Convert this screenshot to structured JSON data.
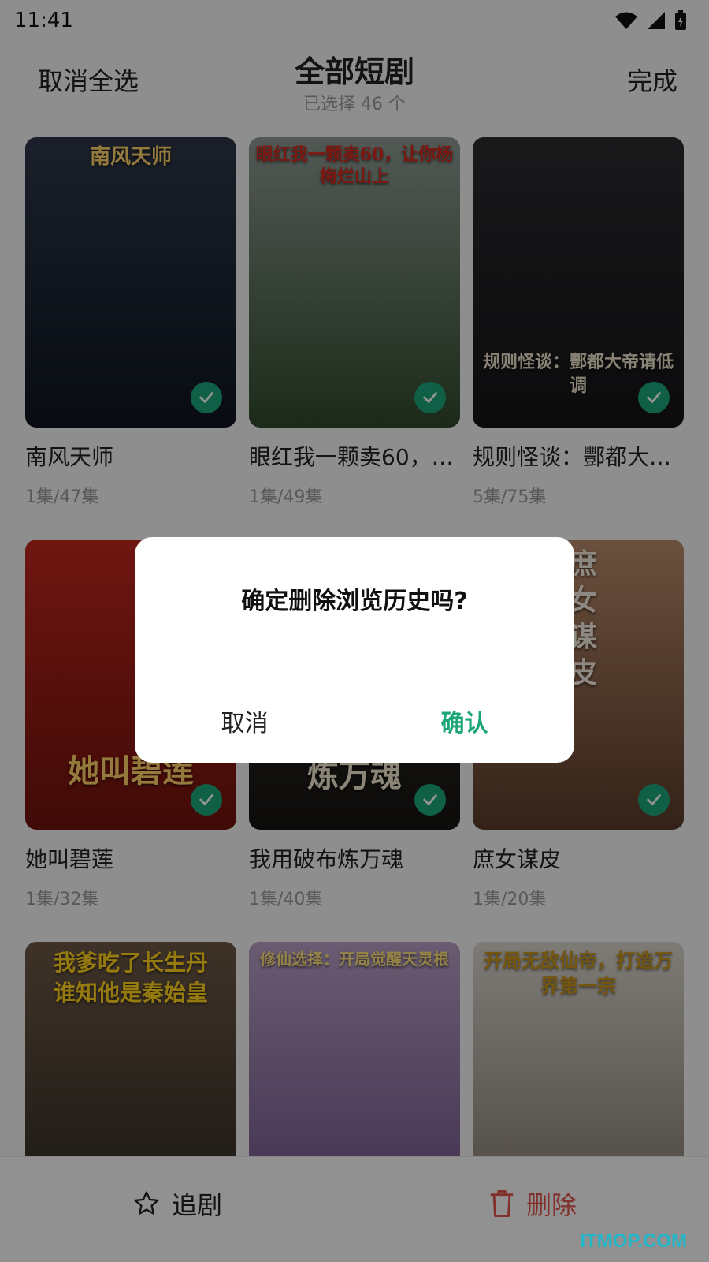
{
  "status": {
    "time": "11:41"
  },
  "header": {
    "deselect_all": "取消全选",
    "title": "全部短剧",
    "subtitle": "已选择 46 个",
    "done": "完成"
  },
  "dramas": [
    {
      "title": "南风天师",
      "episodes": "1集/47集",
      "poster_text": "南风天师",
      "colors": [
        "#2d3648",
        "#0f1520"
      ],
      "selected": true
    },
    {
      "title": "眼红我一颗卖60，…",
      "episodes": "1集/49集",
      "poster_text": "眼红我一颗卖60，让你杨梅烂山上",
      "colors": [
        "#8e9a93",
        "#2f4a2b"
      ],
      "selected": true
    },
    {
      "title": "规则怪谈：酆都大…",
      "episodes": "5集/75集",
      "poster_text": "规则怪谈：酆都大帝请低调",
      "colors": [
        "#2c2c30",
        "#141416"
      ],
      "selected": true
    },
    {
      "title": "她叫碧莲",
      "episodes": "1集/32集",
      "poster_text": "她叫碧莲",
      "colors": [
        "#c0261d",
        "#6e120d"
      ],
      "selected": true
    },
    {
      "title": "我用破布炼万魂",
      "episodes": "1集/40集",
      "poster_text": "炼万魂",
      "colors": [
        "#3a3632",
        "#151412"
      ],
      "selected": true
    },
    {
      "title": "庶女谋皮",
      "episodes": "1集/20集",
      "poster_text": "庶女谋皮",
      "colors": [
        "#b88a6a",
        "#5a3b2a"
      ],
      "selected": true
    },
    {
      "title": "",
      "episodes": "",
      "poster_text": "我爹吃了长生丹 谁知他是秦始皇",
      "colors": [
        "#6d5846",
        "#2a2620"
      ],
      "selected": false
    },
    {
      "title": "",
      "episodes": "",
      "poster_text": "修仙选择：开局觉醒天灵根",
      "colors": [
        "#b69ec4",
        "#6c4f85"
      ],
      "selected": false
    },
    {
      "title": "",
      "episodes": "",
      "poster_text": "开局无敌仙帝，打造万界第一宗",
      "colors": [
        "#d9d4cc",
        "#7d7468"
      ],
      "selected": false
    }
  ],
  "bottom_bar": {
    "follow_label": "追剧",
    "delete_label": "删除",
    "watermark": "ITMOP.COM"
  },
  "dialog": {
    "message": "确定删除浏览历史吗?",
    "cancel": "取消",
    "confirm": "确认"
  },
  "colors": {
    "accent": "#1ba67a",
    "danger": "#e0534a"
  }
}
